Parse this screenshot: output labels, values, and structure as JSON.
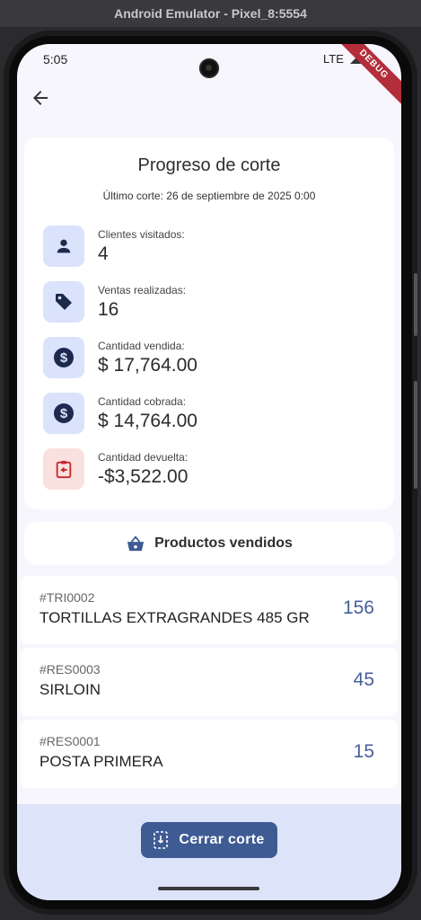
{
  "window": {
    "title": "Android Emulator - Pixel_8:5554"
  },
  "status_bar": {
    "time": "5:05",
    "network": "LTE",
    "debug_label": "DEBUG"
  },
  "summary": {
    "title": "Progreso de corte",
    "subtitle": "Último corte: 26 de septiembre de 2025 0:00",
    "stats": [
      {
        "label": "Clientes visitados:",
        "value": "4",
        "icon": "person-icon"
      },
      {
        "label": "Ventas realizadas:",
        "value": "16",
        "icon": "tag-icon"
      },
      {
        "label": "Cantidad vendida:",
        "value": "$ 17,764.00",
        "icon": "dollar-icon"
      },
      {
        "label": "Cantidad cobrada:",
        "value": "$ 14,764.00",
        "icon": "dollar-icon"
      },
      {
        "label": "Cantidad devuelta:",
        "value": "-$3,522.00",
        "icon": "return-icon"
      }
    ]
  },
  "products": {
    "header": "Productos vendidos",
    "items": [
      {
        "code": "#TRI0002",
        "name": "TORTILLAS EXTRAGRANDES 485 GR",
        "qty": "156"
      },
      {
        "code": "#RES0003",
        "name": "SIRLOIN",
        "qty": "45"
      },
      {
        "code": "#RES0001",
        "name": "POSTA PRIMERA",
        "qty": "15"
      }
    ]
  },
  "actions": {
    "close_label": "Cerrar corte"
  },
  "colors": {
    "primary": "#3f5b94",
    "icon_bg": "#dbe2fb",
    "danger_bg": "#fbe0e0",
    "danger": "#d32f2f",
    "qty": "#45609a"
  }
}
